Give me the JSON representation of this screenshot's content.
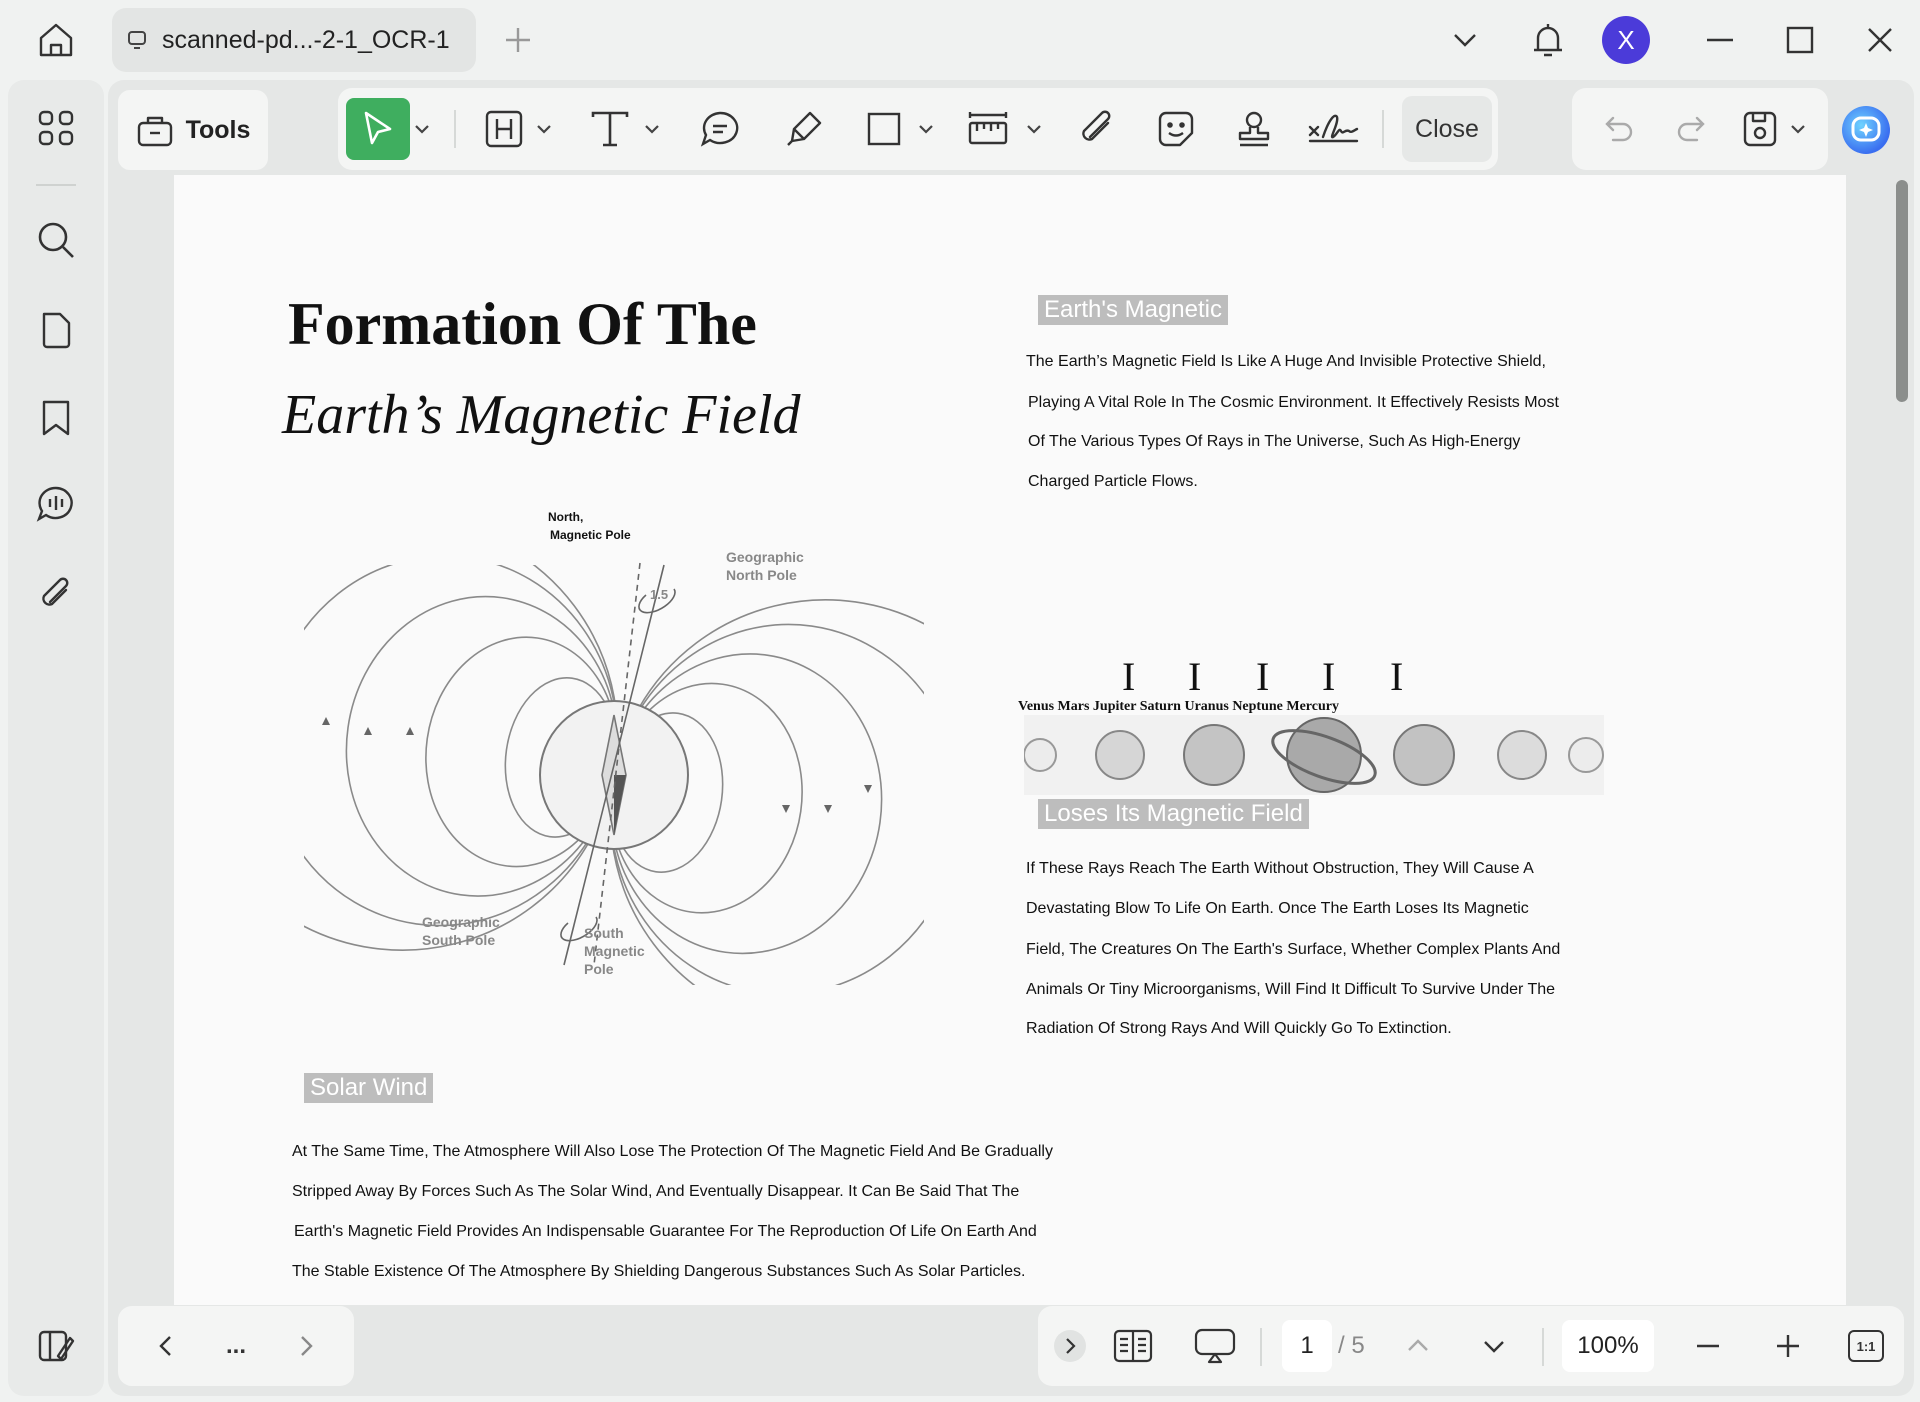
{
  "titlebar": {
    "tab_title": "scanned-pd...-2-1_OCR-1",
    "avatar_letter": "X"
  },
  "toolbar": {
    "tools_label": "Tools",
    "close_label": "Close",
    "accent": "#3fae5f"
  },
  "document": {
    "title_line1": "Formation Of The",
    "title_line2": "Earth’s Magnetic Field",
    "section1": {
      "heading": "Earth's Magnetic",
      "lines": [
        "The Earth’s Magnetic Field Is Like A Huge And Invisible Protective Shield,",
        "Playing A Vital Role In The Cosmic Environment. It Effectively Resists Most",
        "Of The Various Types Of Rays in The Universe, Such As High-Energy",
        "Charged Particle Flows."
      ]
    },
    "section2": {
      "heading": "Loses Its Magnetic Field",
      "lines": [
        "If These Rays Reach The Earth Without Obstruction, They Will Cause A",
        "Devastating Blow To Life On Earth. Once The Earth Loses Its Magnetic",
        "Field, The Creatures On The Earth's Surface, Whether Complex Plants And",
        "Animals Or Tiny Microorganisms, Will Find It Difficult To Survive Under The",
        "Radiation Of Strong Rays And Will Quickly Go To Extinction."
      ]
    },
    "section3": {
      "heading": "Solar Wind",
      "lines": [
        "At The Same Time, The Atmosphere Will Also Lose The Protection Of The Magnetic Field And Be Gradually",
        "Stripped Away By Forces Such As The Solar Wind, And Eventually Disappear. It Can Be Said That The",
        "Earth's Magnetic Field Provides An Indispensable Guarantee For The Reproduction Of Life On Earth And",
        "The Stable Existence Of The Atmosphere By Shielding Dangerous Substances Such As Solar Particles."
      ]
    },
    "diagram": {
      "north_magnetic_line1": "North,",
      "north_magnetic_line2": "Magnetic Pole",
      "geo_north_line1": "Geographic",
      "geo_north_line2": "North Pole",
      "angle": "1.5",
      "geo_south_line1": "Geographic",
      "geo_south_line2": "South Pole",
      "south_magnetic_line1": "South",
      "south_magnetic_line2": "Magnetic",
      "south_magnetic_line3": "Pole"
    },
    "planets_caption": "Venus Mars Jupiter Saturn Uranus Neptune Mercury",
    "cursor_glyph": "I"
  },
  "statusbar": {
    "more_label": "...",
    "page_current": "1",
    "page_total": "/ 5",
    "zoom": "100%",
    "actual_size_label": "1:1"
  }
}
